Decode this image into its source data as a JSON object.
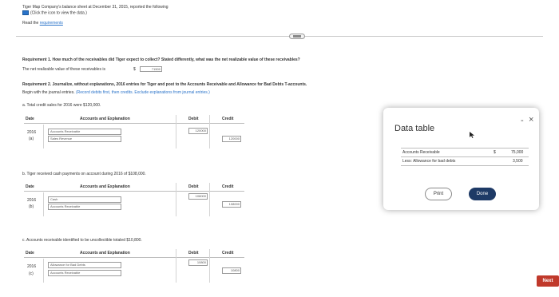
{
  "header": {
    "title": "Tiger Map Company's balance sheet at December 31, 2015, reported the following",
    "click_text": "(Click the icon to view the data.)",
    "requirements_prefix": "Read the",
    "requirements_link": "requirements"
  },
  "requirement1": {
    "question": "Requirement 1. How much of the receivables did Tiger expect to collect? Stated differently, what was the net realizable value of these receivables?",
    "answer_label": "The net realizable value of these receivables is",
    "currency": "$",
    "answer_value": "71500"
  },
  "requirement2": {
    "title": "Requirement 2. Journalize, without explanations, 2016 entries for Tiger and post to the Accounts Receivable and Allowance for Bad Debts T-accounts.",
    "instructions_prefix": "Begin with the journal entries.",
    "instructions_hint": "(Record debits first, then credits. Exclude explanations from journal entries.)"
  },
  "columns": {
    "date": "Date",
    "accounts": "Accounts and Explanation",
    "debit": "Debit",
    "credit": "Credit"
  },
  "entries": [
    {
      "description": "a. Total credit sales for 2016 were $120,000.",
      "year": "2016",
      "letter": "(a)",
      "debit_account": "Accounts Receivable",
      "credit_account": "Sales Revenue",
      "debit_value": "120000",
      "credit_value": "120000"
    },
    {
      "description": "b. Tiger received cash payments on account during 2016 of $108,000.",
      "year": "2016",
      "letter": "(b)",
      "debit_account": "Cash",
      "credit_account": "Accounts Receivable",
      "debit_value": "108000",
      "credit_value": "108000"
    },
    {
      "description": "c. Accounts receivable identified to be uncollectible totaled $10,800.",
      "year": "2016",
      "letter": "(c)",
      "debit_account": "Allowance for Bad Debts",
      "credit_account": "Accounts Receivable",
      "debit_value": "10800",
      "credit_value": "10800"
    }
  ],
  "data_table": {
    "title": "Data table",
    "rows": [
      {
        "label": "Accounts Receivable",
        "currency": "$",
        "value": "75,000"
      },
      {
        "label": "Less: Allowance for bad debts",
        "currency": "",
        "value": "3,500"
      }
    ],
    "print_label": "Print",
    "done_label": "Done",
    "minimize_glyph": "-",
    "close_glyph": "×"
  },
  "footer": {
    "next_label": "Next"
  },
  "colors": {
    "link": "#2a73c9",
    "done_button": "#1e3a66",
    "next_button": "#c0392b"
  },
  "icons": [
    "data-table-icon",
    "expand-handle-icon",
    "minimize-icon",
    "close-icon",
    "cursor-icon"
  ]
}
